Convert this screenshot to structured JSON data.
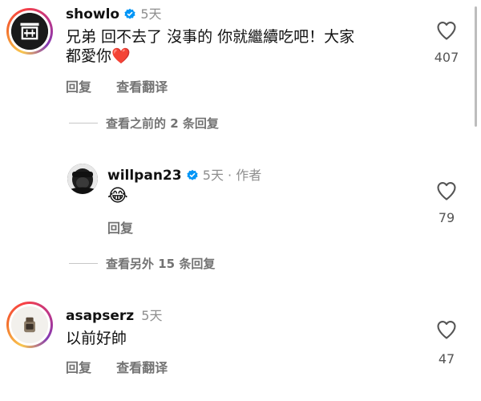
{
  "comments": [
    {
      "username": "showlo",
      "time": "5天",
      "text_line1": "兄弟 回不去了 沒事的 你就繼續吃吧！大家",
      "text_line2": "都愛你",
      "text_emoji": "❤️",
      "likes": "407",
      "reply": "回复",
      "translate": "查看翻译"
    },
    {
      "username": "willpan23",
      "time": "5天 · 作者",
      "emoji": "😂",
      "likes": "79",
      "reply": "回复"
    },
    {
      "username": "asapserz",
      "time": "5天",
      "text": "以前好帥",
      "likes": "47",
      "reply": "回复",
      "translate": "查看翻译"
    }
  ],
  "threads": {
    "previous": "查看之前的 2 条回复",
    "more": "查看另外 15 条回复"
  },
  "colors": {
    "heart_red": "#ed4956",
    "verified_blue": "#0095f6",
    "muted": "#737373"
  }
}
